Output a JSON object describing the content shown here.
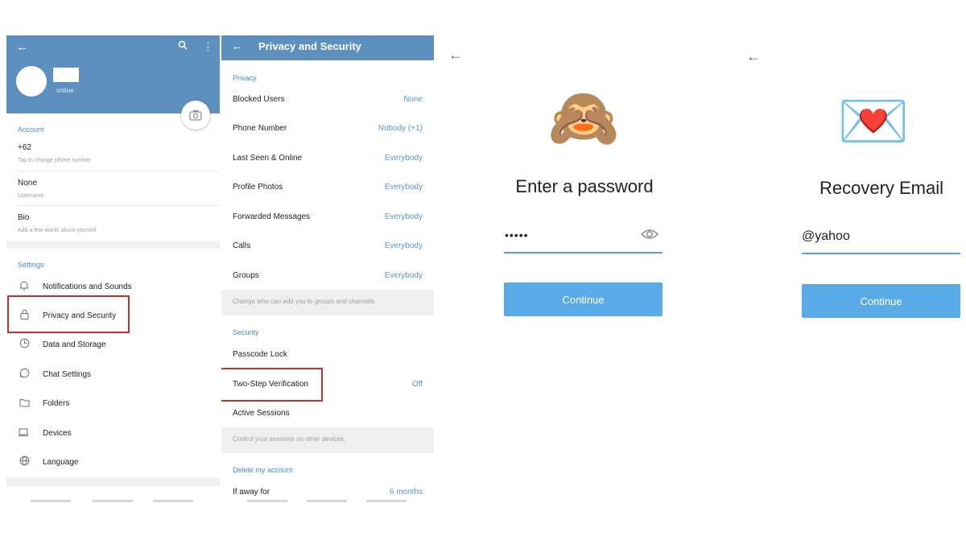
{
  "settings": {
    "status": "online",
    "account_title": "Account",
    "phone": "+62",
    "phone_hint": "Tap to change phone number",
    "username": "None",
    "username_hint": "Username",
    "bio": "Bio",
    "bio_hint": "Add a few words about yourself",
    "settings_title": "Settings",
    "items": [
      {
        "label": "Notifications and Sounds",
        "icon": "bell-icon"
      },
      {
        "label": "Privacy and Security",
        "icon": "lock-icon"
      },
      {
        "label": "Data and Storage",
        "icon": "clock-icon"
      },
      {
        "label": "Chat Settings",
        "icon": "chat-icon"
      },
      {
        "label": "Folders",
        "icon": "folder-icon"
      },
      {
        "label": "Devices",
        "icon": "devices-icon"
      },
      {
        "label": "Language",
        "icon": "globe-icon"
      }
    ]
  },
  "privacy": {
    "title": "Privacy and Security",
    "privacy_section": "Privacy",
    "rows": [
      {
        "label": "Blocked Users",
        "value": "None"
      },
      {
        "label": "Phone Number",
        "value": "Nobody (+1)"
      },
      {
        "label": "Last Seen & Online",
        "value": "Everybody"
      },
      {
        "label": "Profile Photos",
        "value": "Everybody"
      },
      {
        "label": "Forwarded Messages",
        "value": "Everybody"
      },
      {
        "label": "Calls",
        "value": "Everybody"
      },
      {
        "label": "Groups",
        "value": "Everybody"
      }
    ],
    "groups_hint": "Change who can add you to groups and channels.",
    "security_section": "Security",
    "security_rows": [
      {
        "label": "Passcode Lock",
        "value": ""
      },
      {
        "label": "Two-Step Verification",
        "value": "Off"
      },
      {
        "label": "Active Sessions",
        "value": ""
      }
    ],
    "sessions_hint": "Control your sessions on other devices.",
    "delete_section": "Delete my account",
    "away_label": "If away for",
    "away_value": "6 months"
  },
  "password": {
    "emoji": "🙈",
    "title": "Enter a password",
    "value": "•••••",
    "button": "Continue"
  },
  "recovery": {
    "emoji": "💌",
    "title": "Recovery Email",
    "value": "@yahoo",
    "button": "Continue"
  },
  "colors": {
    "header": "#5d8fbf",
    "accent": "#4a8ac7",
    "highlight": "#c8302e",
    "button": "#5aaae8"
  }
}
